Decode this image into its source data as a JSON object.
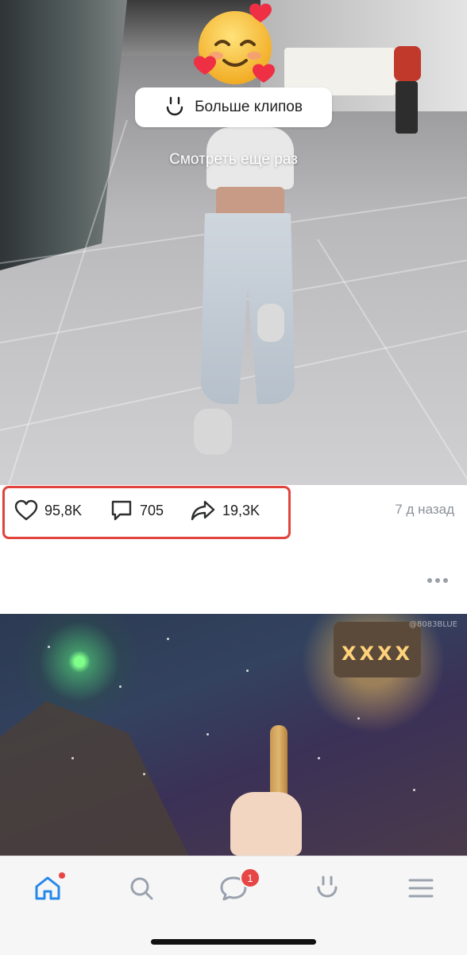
{
  "clip": {
    "more_clips_label": "Больше клипов",
    "watch_again_label": "Смотреть ещё раз"
  },
  "actions": {
    "likes": "95,8K",
    "comments": "705",
    "shares": "19,3K",
    "posted_ago": "7 д назад"
  },
  "post2": {
    "watermark": "@8083BLUE",
    "lantern_text": "XXXX"
  },
  "tabbar": {
    "tabs": [
      {
        "name": "home",
        "icon": "home-icon",
        "active": true,
        "has_dot": true
      },
      {
        "name": "search",
        "icon": "search-icon",
        "active": false
      },
      {
        "name": "messages",
        "icon": "chat-bubble-icon",
        "active": false,
        "badge": "1"
      },
      {
        "name": "clips",
        "icon": "clips-icon",
        "active": false
      },
      {
        "name": "menu",
        "icon": "hamburger-icon",
        "active": false
      }
    ]
  },
  "colors": {
    "accent": "#2688eb",
    "highlight": "#e0443c",
    "badge": "#e64646",
    "muted": "#8d9299"
  }
}
